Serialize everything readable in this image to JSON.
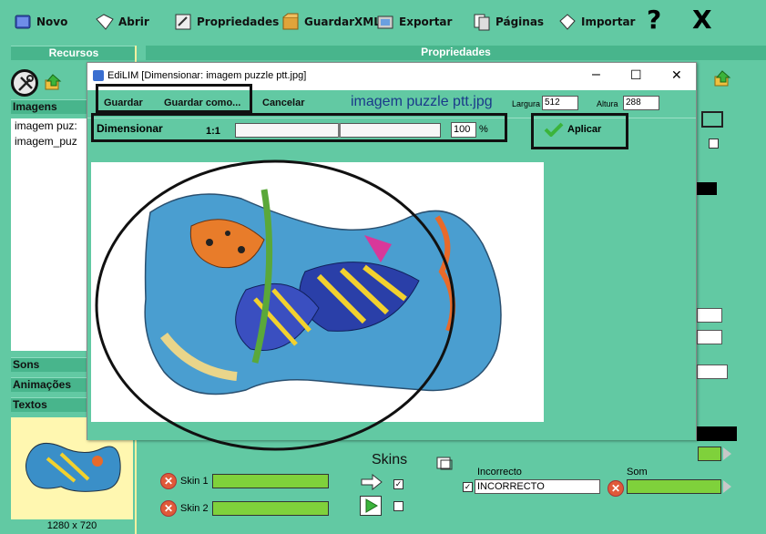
{
  "toolbar": {
    "novo": "Novo",
    "abrir": "Abrir",
    "propriedades": "Propriedades",
    "guardar_xml": "GuardarXML",
    "exportar": "Exportar",
    "paginas": "Páginas",
    "importar": "Importar",
    "help": "?",
    "close": "X"
  },
  "left": {
    "recursos_header": "Recursos",
    "imagens_header": "Imagens",
    "images": [
      "imagem puz:",
      "imagem_puz"
    ],
    "sons": "Sons",
    "animacoes": "Animações",
    "textos": "Textos",
    "thumb_caption": "1280 x 720"
  },
  "main": {
    "propriedades_header": "Propriedades",
    "skins_label": "Skins",
    "skin1": "Skin 1",
    "skin2": "Skin 2",
    "incorrecto_label": "Incorrecto",
    "incorrecto_value": "INCORRECTO",
    "som_label": "Som"
  },
  "dialog": {
    "title": "EdiLIM [Dimensionar: imagem puzzle ptt.jpg]",
    "minimize": "–",
    "maximize": "☐",
    "close": "✕",
    "guardar": "Guardar",
    "guardar_como": "Guardar como...",
    "cancelar": "Cancelar",
    "filename": "imagem puzzle ptt.jpg",
    "largura_label": "Largura",
    "largura_value": "512",
    "altura_label": "Altura",
    "altura_value": "288",
    "dimensionar_label": "Dimensionar",
    "ratio": "1:1",
    "percent_value": "100",
    "percent_sign": "%",
    "scale_percent": 100,
    "aplicar": "Aplicar"
  },
  "colors": {
    "panel_green": "#62c9a3",
    "header_green": "#48b58c",
    "bar_green": "#7fd13b",
    "thumb_bg": "#fff7b0"
  }
}
